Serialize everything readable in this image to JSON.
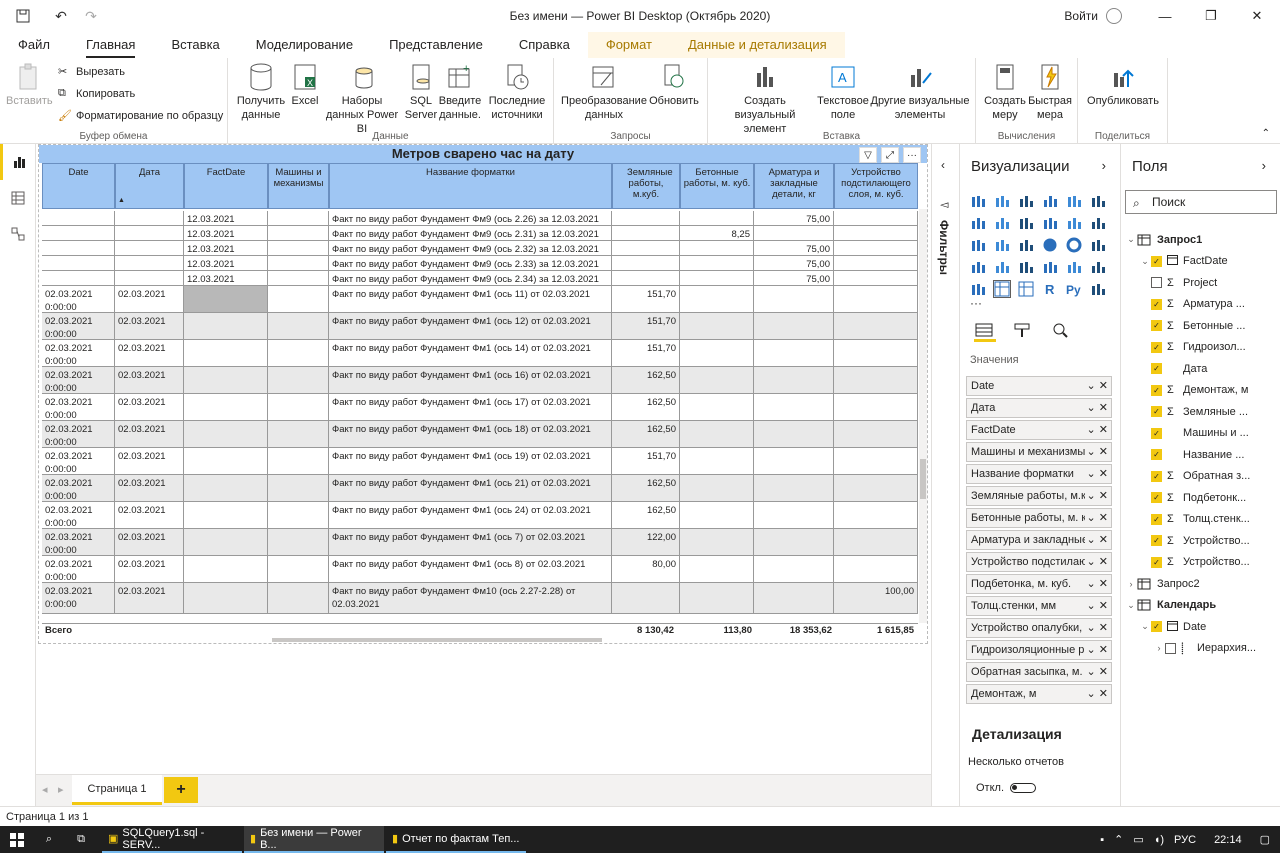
{
  "window": {
    "title": "Без имени — Power BI Desktop (Октябрь 2020)",
    "sign_in": "Войти"
  },
  "tabs": [
    "Файл",
    "Главная",
    "Вставка",
    "Моделирование",
    "Представление",
    "Справка",
    "Формат",
    "Данные и детализация"
  ],
  "ribbon": {
    "clipboard": {
      "paste": "Вставить",
      "cut": "Вырезать",
      "copy": "Копировать",
      "format_painter": "Форматирование по образцу",
      "label": "Буфер обмена"
    },
    "data": {
      "get_data": "Получить данные",
      "excel": "Excel",
      "datasets": "Наборы данных Power BI",
      "sql": "SQL Server",
      "enter_data": "Введите данные.",
      "recent": "Последние источники",
      "label": "Данные"
    },
    "queries": {
      "transform": "Преобразование данных",
      "refresh": "Обновить",
      "label": "Запросы"
    },
    "insert": {
      "new_visual": "Создать визуальный элемент",
      "text_box": "Текстовое поле",
      "more_visuals": "Другие визуальные элементы",
      "label": "Вставка"
    },
    "calc": {
      "new_measure": "Создать меру",
      "quick_measure": "Быстрая мера",
      "label": "Вычисления"
    },
    "share": {
      "publish": "Опубликовать",
      "label": "Поделиться"
    }
  },
  "visual": {
    "title": "Метров сварено час на дату",
    "columns": [
      "Date",
      "Дата",
      "FactDate",
      "Машины и механизмы",
      "Название форматки",
      "Земляные работы, м.куб.",
      "Бетонные работы, м. куб.",
      "Арматура и закладные детали, кг",
      "Устройство подстилающего слоя, м. куб."
    ],
    "rows": [
      {
        "date": "",
        "data": "",
        "fact": "12.03.2021 0:00:00",
        "mach": "",
        "name": "Факт по виду работ Фундамент Фм9 (ось 2.26) за 12.03.2021",
        "zem": "",
        "bet": "",
        "arm": "75,00",
        "ust": ""
      },
      {
        "date": "",
        "data": "",
        "fact": "12.03.2021 0:00:00",
        "mach": "",
        "name": "Факт по виду работ Фундамент Фм9 (ось 2.31) за 12.03.2021",
        "zem": "",
        "bet": "8,25",
        "arm": "",
        "ust": ""
      },
      {
        "date": "",
        "data": "",
        "fact": "12.03.2021 0:00:00",
        "mach": "",
        "name": "Факт по виду работ Фундамент Фм9 (ось 2.32) за 12.03.2021",
        "zem": "",
        "bet": "",
        "arm": "75,00",
        "ust": ""
      },
      {
        "date": "",
        "data": "",
        "fact": "12.03.2021 0:00:00",
        "mach": "",
        "name": "Факт по виду работ Фундамент Фм9 (ось 2.33) за 12.03.2021",
        "zem": "",
        "bet": "",
        "arm": "75,00",
        "ust": ""
      },
      {
        "date": "",
        "data": "",
        "fact": "12.03.2021 0:00:00",
        "mach": "",
        "name": "Факт по виду работ Фундамент Фм9 (ось 2.34) за 12.03.2021",
        "zem": "",
        "bet": "",
        "arm": "75,00",
        "ust": ""
      },
      {
        "date": "02.03.2021 0:00:00",
        "data": "02.03.2021",
        "fact": "",
        "mach": "",
        "name": "Факт по виду работ Фундамент Фм1 (ось 11) от 02.03.2021",
        "zem": "151,70",
        "bet": "",
        "arm": "",
        "ust": ""
      },
      {
        "date": "02.03.2021 0:00:00",
        "data": "02.03.2021",
        "fact": "",
        "mach": "",
        "name": "Факт по виду работ Фундамент Фм1 (ось 12) от 02.03.2021",
        "zem": "151,70",
        "bet": "",
        "arm": "",
        "ust": ""
      },
      {
        "date": "02.03.2021 0:00:00",
        "data": "02.03.2021",
        "fact": "",
        "mach": "",
        "name": "Факт по виду работ Фундамент Фм1 (ось 14) от 02.03.2021",
        "zem": "151,70",
        "bet": "",
        "arm": "",
        "ust": ""
      },
      {
        "date": "02.03.2021 0:00:00",
        "data": "02.03.2021",
        "fact": "",
        "mach": "",
        "name": "Факт по виду работ Фундамент Фм1 (ось 16) от 02.03.2021",
        "zem": "162,50",
        "bet": "",
        "arm": "",
        "ust": ""
      },
      {
        "date": "02.03.2021 0:00:00",
        "data": "02.03.2021",
        "fact": "",
        "mach": "",
        "name": "Факт по виду работ Фундамент Фм1 (ось 17) от 02.03.2021",
        "zem": "162,50",
        "bet": "",
        "arm": "",
        "ust": ""
      },
      {
        "date": "02.03.2021 0:00:00",
        "data": "02.03.2021",
        "fact": "",
        "mach": "",
        "name": "Факт по виду работ Фундамент Фм1 (ось 18) от 02.03.2021",
        "zem": "162,50",
        "bet": "",
        "arm": "",
        "ust": ""
      },
      {
        "date": "02.03.2021 0:00:00",
        "data": "02.03.2021",
        "fact": "",
        "mach": "",
        "name": "Факт по виду работ Фундамент Фм1 (ось 19) от 02.03.2021",
        "zem": "151,70",
        "bet": "",
        "arm": "",
        "ust": ""
      },
      {
        "date": "02.03.2021 0:00:00",
        "data": "02.03.2021",
        "fact": "",
        "mach": "",
        "name": "Факт по виду работ Фундамент Фм1 (ось 21) от 02.03.2021",
        "zem": "162,50",
        "bet": "",
        "arm": "",
        "ust": ""
      },
      {
        "date": "02.03.2021 0:00:00",
        "data": "02.03.2021",
        "fact": "",
        "mach": "",
        "name": "Факт по виду работ Фундамент Фм1 (ось 24) от 02.03.2021",
        "zem": "162,50",
        "bet": "",
        "arm": "",
        "ust": ""
      },
      {
        "date": "02.03.2021 0:00:00",
        "data": "02.03.2021",
        "fact": "",
        "mach": "",
        "name": "Факт по виду работ Фундамент Фм1 (ось 7) от 02.03.2021",
        "zem": "122,00",
        "bet": "",
        "arm": "",
        "ust": ""
      },
      {
        "date": "02.03.2021 0:00:00",
        "data": "02.03.2021",
        "fact": "",
        "mach": "",
        "name": "Факт по виду работ Фундамент Фм1 (ось 8) от 02.03.2021",
        "zem": "80,00",
        "bet": "",
        "arm": "",
        "ust": ""
      },
      {
        "date": "02.03.2021 0:00:00",
        "data": "02.03.2021",
        "fact": "",
        "mach": "",
        "name": "Факт по виду работ Фундамент Фм10 (ось 2.27-2.28) от 02.03.2021",
        "zem": "",
        "bet": "",
        "arm": "",
        "ust": "100,00"
      }
    ],
    "totals": {
      "label": "Всего",
      "zem": "8 130,42",
      "bet": "113,80",
      "arm": "18 353,62",
      "ust": "1 615,85"
    }
  },
  "page_tab": "Страница 1",
  "filters_label": "Фильтры",
  "viz_pane": {
    "title": "Визуализации",
    "values_label": "Значения",
    "wells": [
      "Date",
      "Дата",
      "FactDate",
      "Машины и механизмы",
      "Название форматки",
      "Земляные работы, м.куб",
      "Бетонные работы, м. куб",
      "Арматура и закладные",
      "Устройство подстилаю",
      "Подбетонка, м. куб.",
      "Толщ.стенки, мм",
      "Устройство опалубки, п",
      "Гидроизоляционные р",
      "Обратная засыпка, м. к",
      "Демонтаж, м"
    ],
    "drill_title": "Детализация",
    "multi_reports": "Несколько отчетов",
    "toggle_off": "Откл."
  },
  "fields_pane": {
    "title": "Поля",
    "search_placeholder": "Поиск",
    "tree": [
      {
        "label": "Запрос1",
        "level": 0,
        "kind": "table",
        "expanded": true,
        "bold": true
      },
      {
        "label": "FactDate",
        "level": 1,
        "kind": "date",
        "checked": true,
        "expanded": true
      },
      {
        "label": "Project",
        "level": 1,
        "kind": "sigma",
        "checked": false
      },
      {
        "label": "Арматура ...",
        "level": 1,
        "kind": "sigma",
        "checked": true
      },
      {
        "label": "Бетонные ...",
        "level": 1,
        "kind": "sigma",
        "checked": true
      },
      {
        "label": "Гидроизол...",
        "level": 1,
        "kind": "sigma",
        "checked": true
      },
      {
        "label": "Дата",
        "level": 1,
        "kind": "text",
        "checked": true
      },
      {
        "label": "Демонтаж, м",
        "level": 1,
        "kind": "sigma",
        "checked": true
      },
      {
        "label": "Земляные ...",
        "level": 1,
        "kind": "sigma",
        "checked": true
      },
      {
        "label": "Машины и ...",
        "level": 1,
        "kind": "text",
        "checked": true
      },
      {
        "label": "Название ...",
        "level": 1,
        "kind": "text",
        "checked": true
      },
      {
        "label": "Обратная з...",
        "level": 1,
        "kind": "sigma",
        "checked": true
      },
      {
        "label": "Подбетонк...",
        "level": 1,
        "kind": "sigma",
        "checked": true
      },
      {
        "label": "Толщ.стенк...",
        "level": 1,
        "kind": "sigma",
        "checked": true
      },
      {
        "label": "Устройство...",
        "level": 1,
        "kind": "sigma",
        "checked": true
      },
      {
        "label": "Устройство...",
        "level": 1,
        "kind": "sigma",
        "checked": true
      },
      {
        "label": "Запрос2",
        "level": 0,
        "kind": "table",
        "expanded": false
      },
      {
        "label": "Календарь",
        "level": 0,
        "kind": "table",
        "expanded": true,
        "bold": true
      },
      {
        "label": "Date",
        "level": 1,
        "kind": "date",
        "checked": true,
        "expanded": true
      },
      {
        "label": "Иерархия...",
        "level": 2,
        "kind": "hier",
        "checked": false,
        "expanded": false
      }
    ]
  },
  "status": "Страница 1 из 1",
  "taskbar": {
    "apps": [
      "SQLQuery1.sql - SERV...",
      "Без имени — Power B...",
      "Отчет по фактам Теп..."
    ],
    "lang": "РУС",
    "time": "22:14"
  },
  "colors": {
    "accent": "#f2c811",
    "header_blue": "#9fc6f3"
  }
}
